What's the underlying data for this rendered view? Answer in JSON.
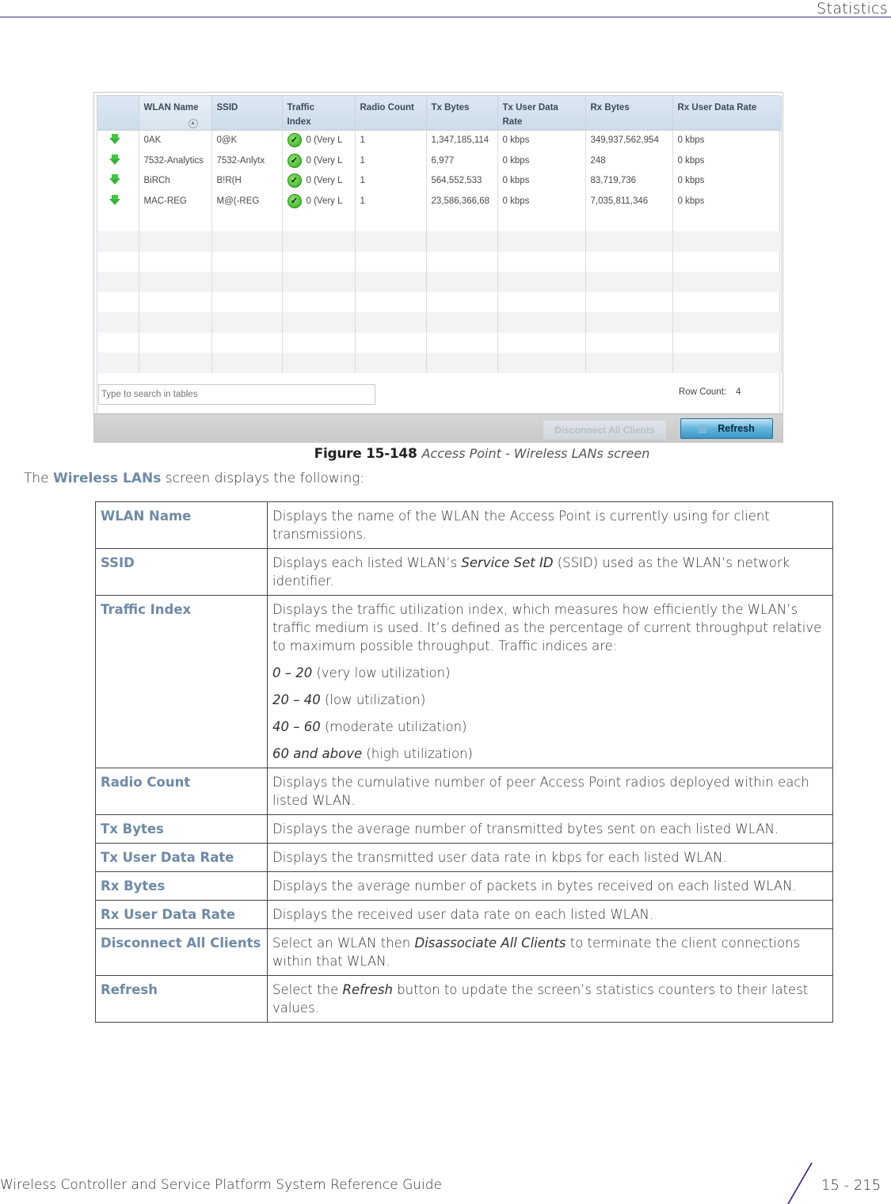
{
  "header": {
    "section": "Statistics"
  },
  "figure": {
    "columns": [
      {
        "label": ""
      },
      {
        "label": "WLAN Name",
        "sorted": true
      },
      {
        "label": "SSID"
      },
      {
        "label": "Traffic Index"
      },
      {
        "label": "Radio Count"
      },
      {
        "label": "Tx Bytes"
      },
      {
        "label": "Tx User Data Rate"
      },
      {
        "label": "Rx Bytes"
      },
      {
        "label": "Rx User Data Rate"
      }
    ],
    "rows": [
      {
        "status_icon": "green-down-arrow-icon",
        "wlan_name": "0AK",
        "ssid": "0@K",
        "traffic_index": "0 (Very L",
        "radio_count": "1",
        "tx_bytes": "1,347,185,114",
        "tx_rate": "0 kbps",
        "rx_bytes": "349,937,562,954",
        "rx_rate": "0 kbps"
      },
      {
        "status_icon": "green-down-arrow-icon",
        "wlan_name": "7532-Analytics",
        "ssid": "7532-Anlytx",
        "traffic_index": "0 (Very L",
        "radio_count": "1",
        "tx_bytes": "6,977",
        "tx_rate": "0 kbps",
        "rx_bytes": "248",
        "rx_rate": "0 kbps"
      },
      {
        "status_icon": "green-down-arrow-icon",
        "wlan_name": "BiRCh",
        "ssid": "B!R(H",
        "traffic_index": "0 (Very L",
        "radio_count": "1",
        "tx_bytes": "564,552,533",
        "tx_rate": "0 kbps",
        "rx_bytes": "83,719,736",
        "rx_rate": "0 kbps"
      },
      {
        "status_icon": "green-down-arrow-icon",
        "wlan_name": "MAC-REG",
        "ssid": "M@(-REG",
        "traffic_index": "0 (Very L",
        "radio_count": "1",
        "tx_bytes": "23,586,366,68",
        "tx_rate": "0 kbps",
        "rx_bytes": "7,035,811,346",
        "rx_rate": "0 kbps"
      }
    ],
    "search_placeholder": "Type to search in tables",
    "row_count_label": "Row Count:",
    "row_count_value": "4",
    "buttons": {
      "disconnect": "Disconnect All Clients",
      "refresh": "Refresh"
    },
    "colors": {
      "status_green": "#38b33a",
      "header_blue": "#cddcea",
      "refresh_blue": "#3b98c8"
    }
  },
  "caption": {
    "number": "Figure 15-148",
    "title": "Access Point - Wireless LANs screen"
  },
  "intro": {
    "prefix": "The ",
    "highlight": "Wireless LANs",
    "suffix": " screen displays the following:"
  },
  "definitions": [
    {
      "term": "WLAN Name",
      "desc": "Displays the name of the WLAN the Access Point is currently using for client transmissions."
    },
    {
      "term": "SSID",
      "desc_pre": "Displays each listed WLAN’s ",
      "desc_em": "Service Set ID",
      "desc_post": " (SSID) used as the WLAN’s network identifier."
    },
    {
      "term": "Traffic Index",
      "desc": "Displays the traffic utilization index, which measures how efficiently the WLAN’s traffic medium is used. It’s defined as the percentage of current throughput relative to maximum possible throughput. Traffic indices are:",
      "ranges": [
        {
          "range": "0 – 20",
          "label": " (very low utilization)"
        },
        {
          "range": "20 – 40",
          "label": " (low utilization)"
        },
        {
          "range": "40 – 60",
          "label": " (moderate utilization)"
        },
        {
          "range": "60 and above",
          "label": " (high utilization)"
        }
      ]
    },
    {
      "term": "Radio Count",
      "desc": "Displays the cumulative number of peer Access Point radios deployed within each listed WLAN."
    },
    {
      "term": "Tx Bytes",
      "desc": "Displays the average number of transmitted bytes sent on each listed WLAN."
    },
    {
      "term": "Tx User Data Rate",
      "desc": "Displays the transmitted user data rate in kbps for each listed WLAN."
    },
    {
      "term": "Rx Bytes",
      "desc": "Displays the average number of packets in bytes received on each listed WLAN."
    },
    {
      "term": "Rx User Data Rate",
      "desc": "Displays the received user data rate on each listed WLAN."
    },
    {
      "term": "Disconnect All Clients",
      "desc_pre": "Select an WLAN then ",
      "desc_em": "Disassociate All Clients",
      "desc_post": " to terminate the client connections within that WLAN."
    },
    {
      "term": "Refresh",
      "desc_pre": "Select the ",
      "desc_em": "Refresh",
      "desc_post": " button to update the screen’s statistics counters to their latest values."
    }
  ],
  "footer": {
    "guide_title": "Wireless Controller and Service Platform System Reference Guide",
    "page_number": "15 - 215",
    "accent_color": "#4b2a8e",
    "term_color": "#6e8aa6"
  }
}
